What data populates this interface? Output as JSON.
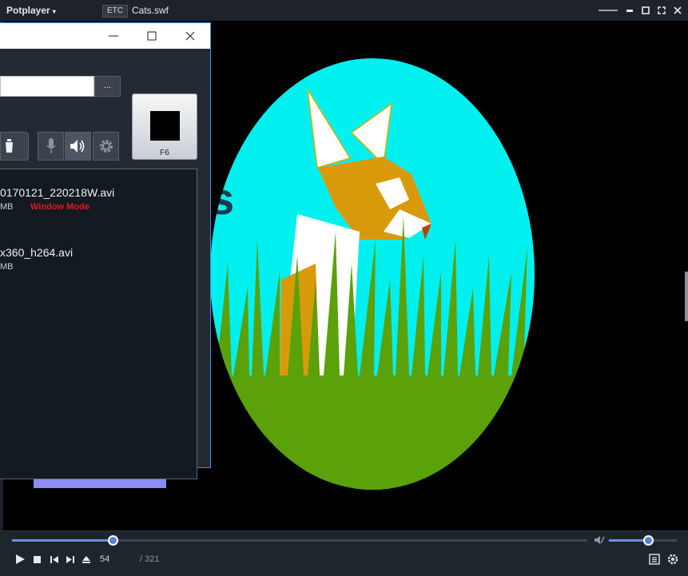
{
  "app": {
    "name": "Potplayer",
    "tag": "ETC",
    "file": "Cats.swf"
  },
  "dialog": {
    "browse_label": "...",
    "hotkey_label": "F6",
    "items": [
      {
        "name": "0170121_220218W.avi",
        "size": "MB",
        "mode": "Window Mode"
      },
      {
        "name": "x360_h264.avi",
        "size": "MB"
      }
    ]
  },
  "player": {
    "position": "54",
    "duration": "/ 321",
    "seek_progress": 0.175,
    "volume_level": 0.58
  },
  "colors": {
    "sky": "#00f0f0",
    "grass": "#5aa10a",
    "cat_orange": "#d89a0a",
    "accent": "#6e8fdc"
  },
  "icons": [
    "dropdown-caret-icon",
    "minimize-icon",
    "maximize-icon",
    "close-icon",
    "trash-icon",
    "microphone-icon",
    "speaker-icon",
    "gear-icon",
    "play-icon",
    "stop-icon",
    "prev-icon",
    "next-icon",
    "eject-icon",
    "mute-icon",
    "playlist-icon",
    "settings-icon"
  ]
}
